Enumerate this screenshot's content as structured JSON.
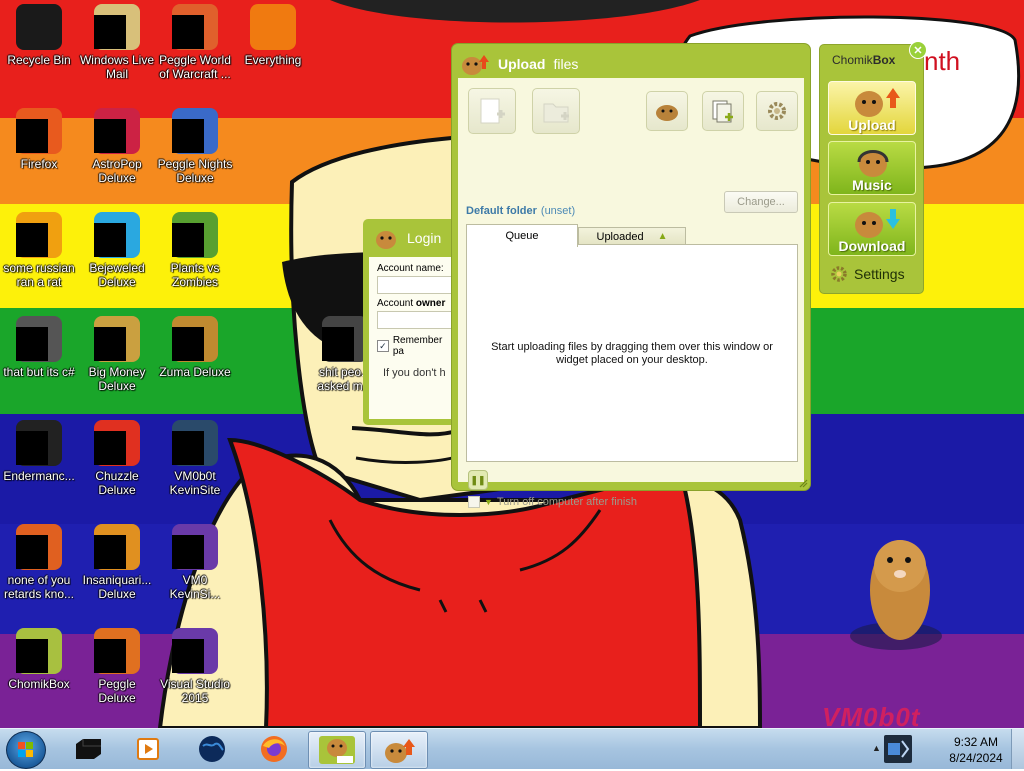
{
  "desktop": {
    "icons": [
      {
        "label": "Recycle Bin",
        "icon": "recycle-bin-icon",
        "color": "#1a1a1a"
      },
      {
        "label": "Windows Live Mail",
        "icon": "mail-icon",
        "color": "#d8c07a"
      },
      {
        "label": "Peggle World of Warcraft ...",
        "icon": "peggle-wow-icon",
        "color": "#e0602c"
      },
      {
        "label": "Everything",
        "icon": "everything-search-icon",
        "color": "#f07a10"
      },
      {
        "label": "Firefox",
        "icon": "firefox-icon",
        "color": "#e85a1e"
      },
      {
        "label": "AstroPop Deluxe",
        "icon": "astropop-icon",
        "color": "#cc2244"
      },
      {
        "label": "Peggle Nights Deluxe",
        "icon": "peggle-nights-icon",
        "color": "#3a6ac8"
      },
      {
        "label": "some russian ran a rat",
        "icon": "rat-app-icon",
        "color": "#f0a010"
      },
      {
        "label": "Bejeweled Deluxe",
        "icon": "bejeweled-icon",
        "color": "#2aa8e0"
      },
      {
        "label": "Plants vs Zombies",
        "icon": "plants-vs-zombies-icon",
        "color": "#58a030"
      },
      {
        "label": "that but its c#",
        "icon": "csharp-app-icon",
        "color": "#555555"
      },
      {
        "label": "Big Money Deluxe",
        "icon": "big-money-icon",
        "color": "#caa040"
      },
      {
        "label": "Zuma Deluxe",
        "icon": "zuma-icon",
        "color": "#c08a30"
      },
      {
        "label": "Endermanc...",
        "icon": "terminal-icon",
        "color": "#222222"
      },
      {
        "label": "Chuzzle Deluxe",
        "icon": "chuzzle-icon",
        "color": "#e03020"
      },
      {
        "label": "VM0b0t KevinSite",
        "icon": "vm-kevinsite-icon",
        "color": "#2a4a6a"
      },
      {
        "label": "none of you retards kno...",
        "icon": "peggle-app-icon",
        "color": "#e06020"
      },
      {
        "label": "Insaniquari... Deluxe",
        "icon": "insaniquarium-icon",
        "color": "#e09020"
      },
      {
        "label": "VM0 KevinSi...",
        "icon": "vm-kevinsite-2-icon",
        "color": "#6a3aa8"
      },
      {
        "label": "ChomikBox",
        "icon": "chomikbox-icon",
        "color": "#a8c040"
      },
      {
        "label": "Peggle Deluxe",
        "icon": "peggle-deluxe-icon",
        "color": "#e07020"
      },
      {
        "label": "Visual Studio 2015",
        "icon": "visual-studio-icon",
        "color": "#6a3aa8"
      },
      {
        "label": "shit peo... asked m...",
        "icon": "folder-icon",
        "color": "#444444"
      }
    ],
    "wallpaper_text": "VM0b0t",
    "speech_text": "nth"
  },
  "login_window": {
    "title": "Login",
    "account_name_label": "Account name:",
    "account_owner_label_prefix": "Account ",
    "account_owner_label_bold": "owner",
    "remember_label": "Remember pa",
    "hint": "If you don't h"
  },
  "upload_window": {
    "title_bold": "Upload",
    "title_rest": " files",
    "default_folder_label": "Default folder",
    "default_folder_value": "(unset)",
    "change_button": "Change...",
    "tabs": {
      "queue": "Queue",
      "uploaded": "Uploaded"
    },
    "empty_message": "Start uploading files by dragging them over this window or widget placed on your desktop.",
    "turn_off_label": "Turn off computer after finish",
    "accent": "#a9c43a"
  },
  "chomikbox_widget": {
    "title_normal": "Chomik",
    "title_bold": "Box",
    "buttons": {
      "upload": "Upload",
      "music": "Music",
      "download": "Download"
    },
    "settings": "Settings"
  },
  "taskbar": {
    "items": [
      {
        "name": "terminal",
        "icon": "terminal-icon"
      },
      {
        "name": "media-player",
        "icon": "media-player-icon"
      },
      {
        "name": "earth",
        "icon": "globe-icon"
      },
      {
        "name": "firefox",
        "icon": "firefox-icon"
      },
      {
        "name": "chomikbox",
        "icon": "chomikbox-icon"
      },
      {
        "name": "chomikbox-upload",
        "icon": "chomikbox-upload-icon"
      }
    ],
    "clock_time": "9:32 AM",
    "clock_date": "8/24/2024"
  }
}
